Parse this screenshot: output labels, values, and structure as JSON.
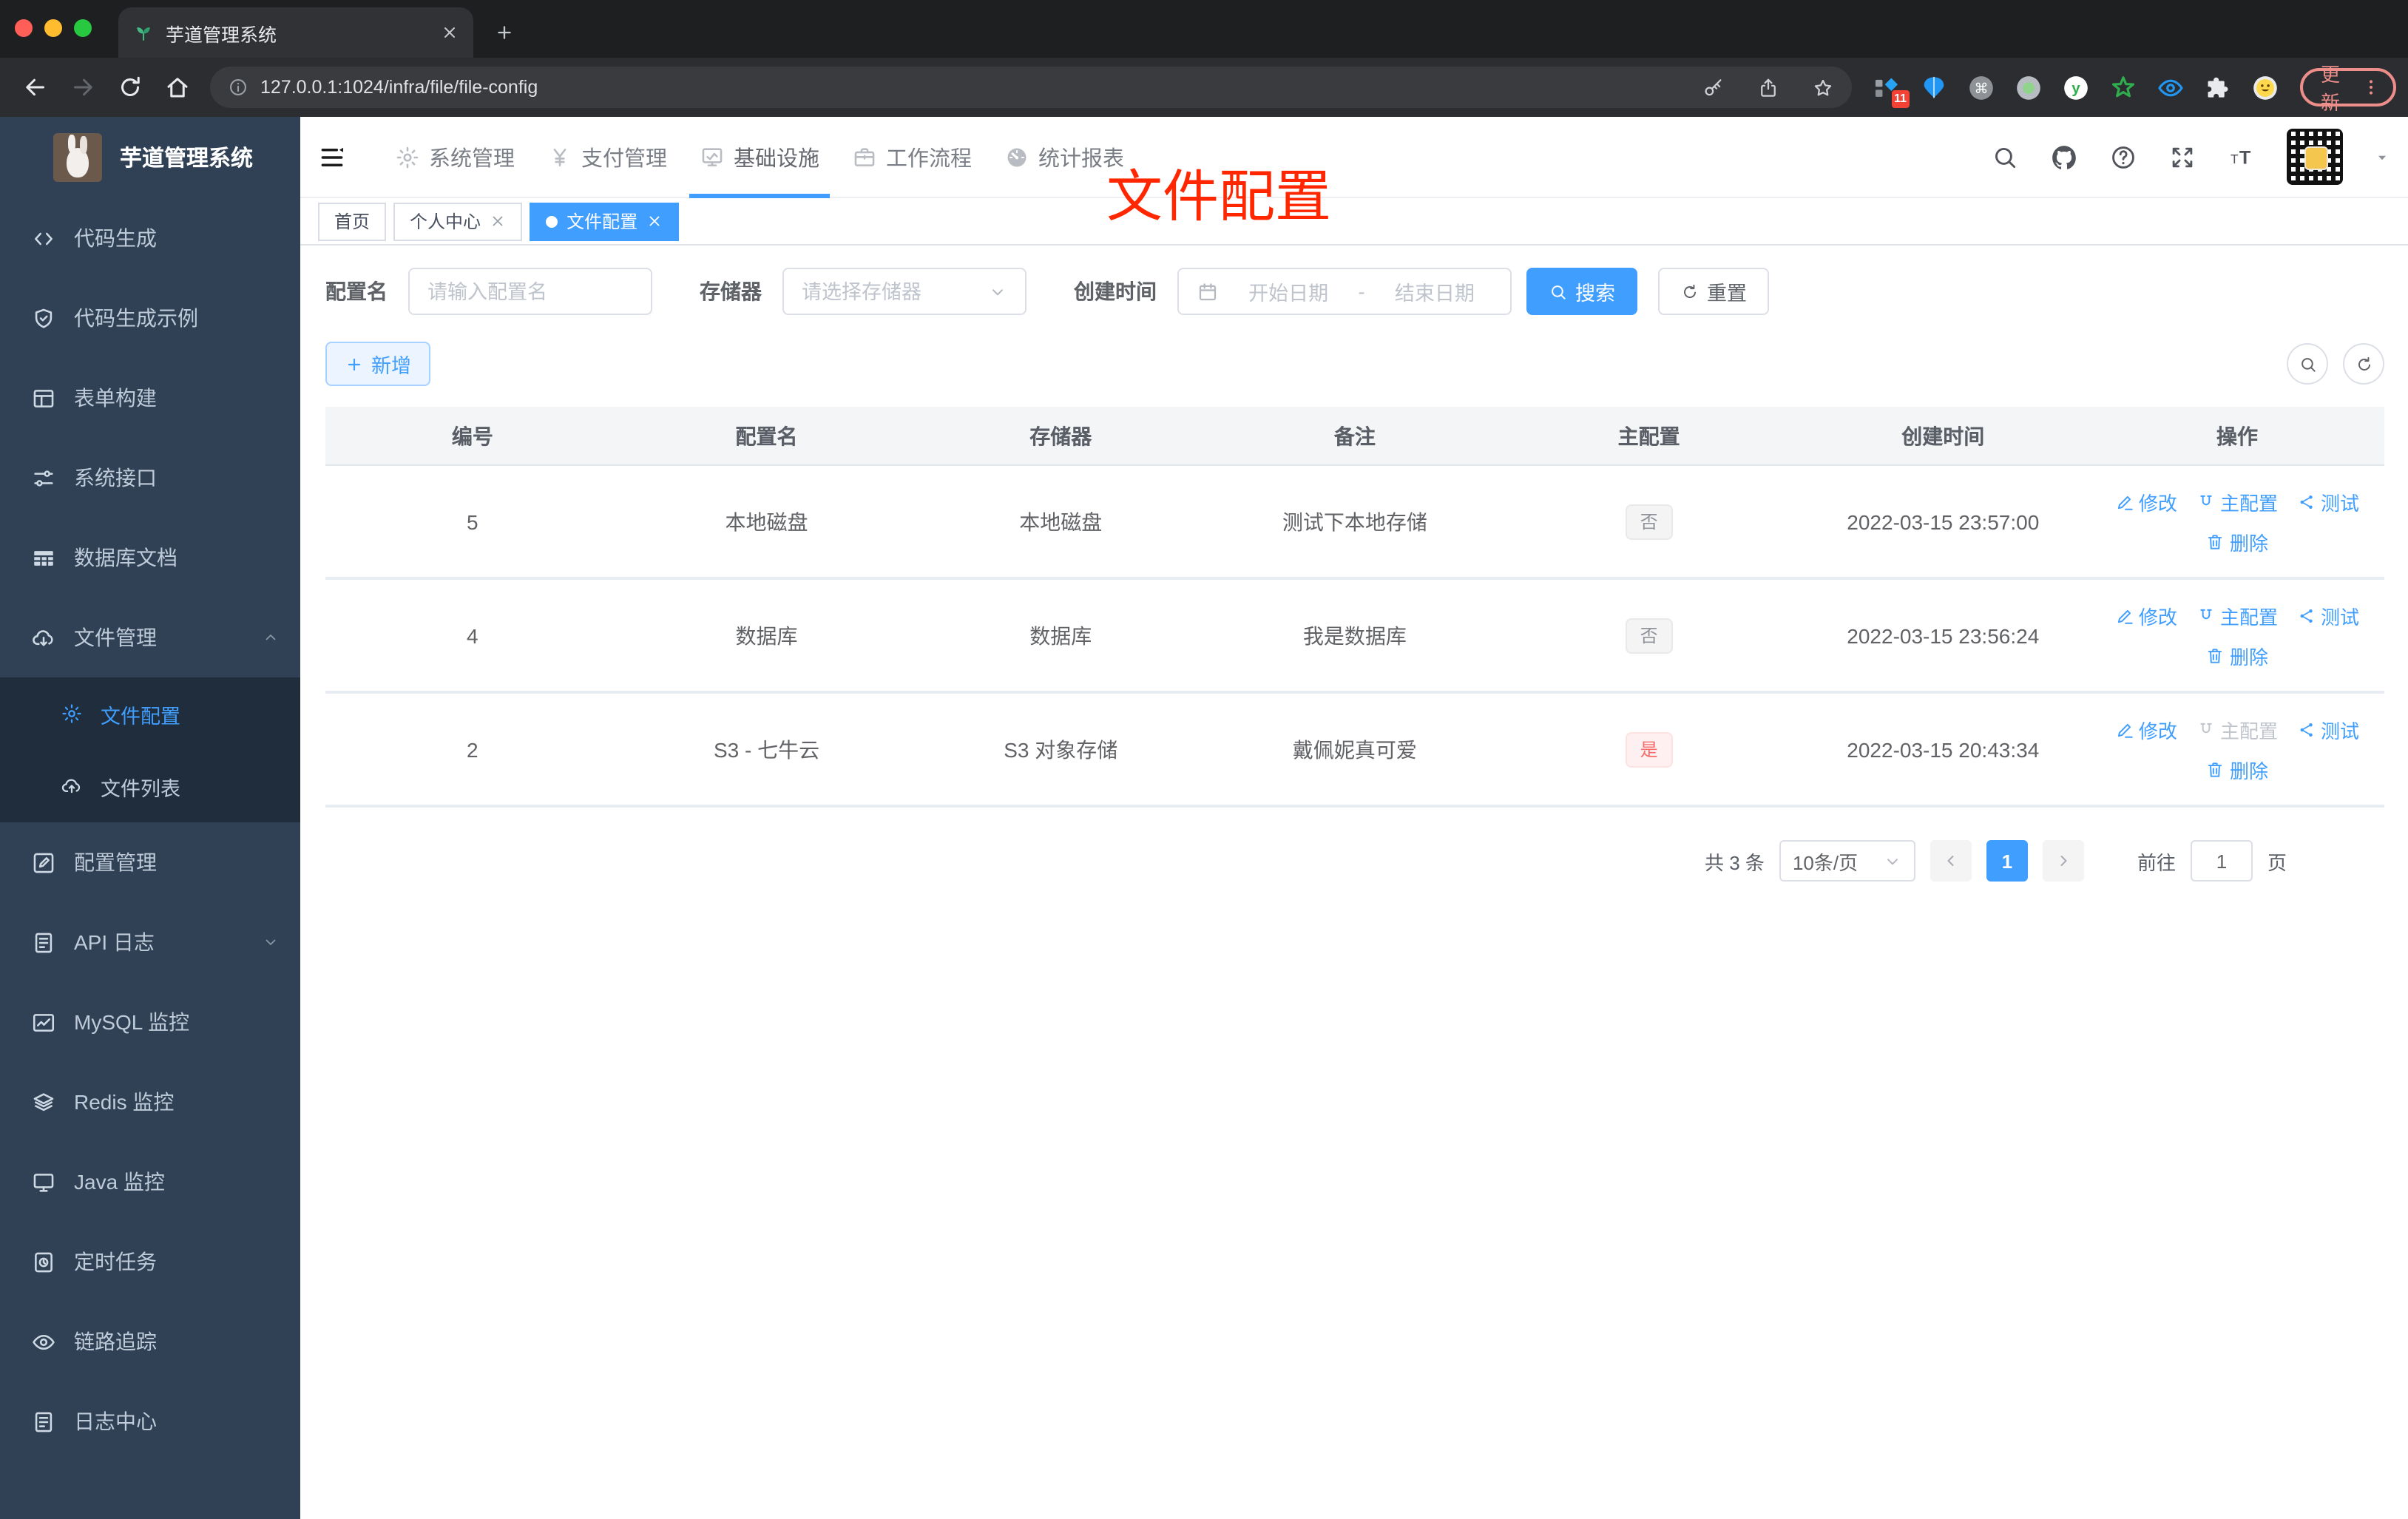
{
  "browser": {
    "tab_title": "芋道管理系统",
    "url": "127.0.0.1:1024/infra/file/file-config",
    "update_label": "更新",
    "extensions": [
      {
        "icon": "ext-diamond-icon",
        "badge": "11"
      },
      {
        "icon": "ext-balloon-icon"
      },
      {
        "icon": "ext-command-icon"
      },
      {
        "icon": "ext-record-icon"
      },
      {
        "icon": "ext-y-icon"
      },
      {
        "icon": "ext-star-icon"
      },
      {
        "icon": "ext-eye-icon"
      },
      {
        "icon": "puzzle-icon"
      },
      {
        "icon": "ext-emoji-icon"
      }
    ]
  },
  "sidebar": {
    "title": "芋道管理系统",
    "items_top": [
      {
        "icon": "code-icon",
        "label": "代码生成"
      },
      {
        "icon": "shield-check-icon",
        "label": "代码生成示例"
      },
      {
        "icon": "form-icon",
        "label": "表单构建"
      },
      {
        "icon": "sliders-icon",
        "label": "系统接口"
      },
      {
        "icon": "table-icon",
        "label": "数据库文档"
      },
      {
        "icon": "cloud-download-icon",
        "label": "文件管理",
        "chevron_icon": "chevron-up-icon"
      }
    ],
    "submenu": [
      {
        "icon": "gear-icon",
        "label": "文件配置",
        "cls": "active"
      },
      {
        "icon": "cloud-upload-icon",
        "label": "文件列表"
      }
    ],
    "items_bottom": [
      {
        "icon": "edit-square-icon",
        "label": "配置管理"
      },
      {
        "icon": "doc-edit-icon",
        "label": "API 日志",
        "chevron_icon": "chevron-down-icon"
      },
      {
        "icon": "chart-icon",
        "label": "MySQL 监控"
      },
      {
        "icon": "layers-icon",
        "label": "Redis 监控"
      },
      {
        "icon": "monitor-icon",
        "label": "Java 监控"
      },
      {
        "icon": "schedule-icon",
        "label": "定时任务"
      },
      {
        "icon": "eye-icon",
        "label": "链路追踪"
      },
      {
        "icon": "doc-edit-icon",
        "label": "日志中心"
      }
    ]
  },
  "topnav": {
    "items": [
      {
        "icon": "gear-icon",
        "label": "系统管理"
      },
      {
        "icon": "yen-icon",
        "label": "支付管理"
      },
      {
        "icon": "infra-icon",
        "label": "基础设施",
        "cls": "active"
      },
      {
        "icon": "briefcase-icon",
        "label": "工作流程"
      },
      {
        "icon": "dashboard-icon",
        "label": "统计报表"
      }
    ]
  },
  "tabs": [
    {
      "label": "首页"
    },
    {
      "label": "个人中心",
      "closable": true
    },
    {
      "label": "文件配置",
      "cls": "active",
      "dot": true,
      "closable": true
    }
  ],
  "annotation": {
    "text": "文件配置"
  },
  "filter": {
    "name_label": "配置名",
    "name_placeholder": "请输入配置名",
    "storage_label": "存储器",
    "storage_placeholder": "请选择存储器",
    "time_label": "创建时间",
    "start_placeholder": "开始日期",
    "range_separator": "-",
    "end_placeholder": "结束日期",
    "search_label": "搜索",
    "reset_label": "重置"
  },
  "toolbar": {
    "add_label": "新增"
  },
  "table": {
    "columns": [
      "编号",
      "配置名",
      "存储器",
      "备注",
      "主配置",
      "创建时间",
      "操作"
    ],
    "rows": [
      {
        "id": "5",
        "name": "本地磁盘",
        "storage": "本地磁盘",
        "remark": "测试下本地存储",
        "master_label": "否",
        "master_cls": "tag-info",
        "created": "2022-03-15 23:57:00",
        "edit_label": "修改",
        "master_link_label": "主配置",
        "master_link_cls": "",
        "test_label": "测试",
        "delete_label": "删除"
      },
      {
        "id": "4",
        "name": "数据库",
        "storage": "数据库",
        "remark": "我是数据库",
        "master_label": "否",
        "master_cls": "tag-info",
        "created": "2022-03-15 23:56:24",
        "edit_label": "修改",
        "master_link_label": "主配置",
        "master_link_cls": "",
        "test_label": "测试",
        "delete_label": "删除"
      },
      {
        "id": "2",
        "name": "S3 - 七牛云",
        "storage": "S3 对象存储",
        "remark": "戴佩妮真可爱",
        "master_label": "是",
        "master_cls": "tag-danger",
        "created": "2022-03-15 20:43:34",
        "edit_label": "修改",
        "master_link_label": "主配置",
        "master_link_cls": "disabled",
        "test_label": "测试",
        "delete_label": "删除"
      }
    ]
  },
  "pagination": {
    "total": "共 3 条",
    "page_size": "10条/页",
    "page": "1",
    "goto_label": "前往",
    "goto_value": "1",
    "page_suffix": "页"
  }
}
